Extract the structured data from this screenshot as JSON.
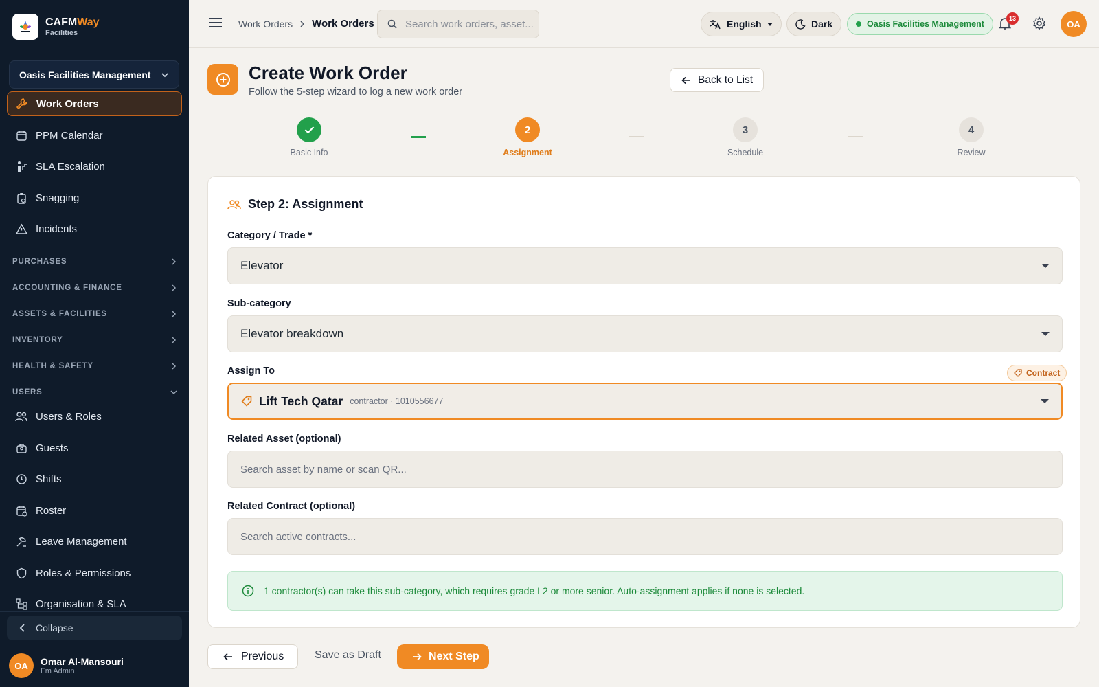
{
  "sidebar": {
    "brand_name_a": "CAFM",
    "brand_name_b": "Way",
    "brand_sub": "Facilities",
    "org": "Oasis Facilities Management",
    "items": [
      {
        "label": "Work Orders",
        "icon": "wrench-icon"
      },
      {
        "label": "PPM Calendar",
        "icon": "calendar-icon"
      },
      {
        "label": "SLA Escalation",
        "icon": "escalation-icon"
      },
      {
        "label": "Snagging",
        "icon": "clipboard-icon"
      },
      {
        "label": "Incidents",
        "icon": "warning-icon"
      }
    ],
    "sections": [
      {
        "label": "PURCHASES",
        "state": "collapsed"
      },
      {
        "label": "ACCOUNTING & FINANCE",
        "state": "collapsed"
      },
      {
        "label": "ASSETS & FACILITIES",
        "state": "collapsed"
      },
      {
        "label": "INVENTORY",
        "state": "collapsed"
      },
      {
        "label": "HEALTH & SAFETY",
        "state": "collapsed"
      },
      {
        "label": "USERS",
        "state": "expanded"
      }
    ],
    "user_items": [
      {
        "label": "Users & Roles",
        "icon": "users-icon"
      },
      {
        "label": "Guests",
        "icon": "guests-icon"
      },
      {
        "label": "Shifts",
        "icon": "clock-icon"
      },
      {
        "label": "Roster",
        "icon": "roster-icon"
      },
      {
        "label": "Leave Management",
        "icon": "leave-icon"
      },
      {
        "label": "Roles & Permissions",
        "icon": "shield-icon"
      },
      {
        "label": "Organisation & SLA",
        "icon": "org-chart-icon"
      }
    ],
    "collapse_label": "Collapse",
    "user": {
      "initials": "OA",
      "name": "Omar Al-Mansouri",
      "role": "Fm Admin"
    }
  },
  "topbar": {
    "breadcrumb": [
      "Work Orders",
      "Work Orders"
    ],
    "search_placeholder": "Search work orders, asset...",
    "language": "English",
    "theme": "Dark",
    "org": "Oasis Facilities Management",
    "notifications": "13",
    "avatar": "OA"
  },
  "page": {
    "title": "Create Work Order",
    "subtitle": "Follow the 5-step wizard to log a new work order",
    "back_label": "Back to List"
  },
  "stepper": [
    {
      "num": "1",
      "label": "Basic Info",
      "state": "done"
    },
    {
      "num": "2",
      "label": "Assignment",
      "state": "active"
    },
    {
      "num": "3",
      "label": "Schedule",
      "state": "todo"
    },
    {
      "num": "4",
      "label": "Review",
      "state": "todo"
    }
  ],
  "form": {
    "title": "Step 2: Assignment",
    "category_label": "Category / Trade *",
    "category_value": "Elevator",
    "subcategory_label": "Sub-category",
    "subcategory_value": "Elevator breakdown",
    "assign_label": "Assign To",
    "contract_tag": "Contract",
    "assign_name": "Lift Tech Qatar",
    "assign_meta": "contractor · 1010556677",
    "asset_label": "Related Asset (optional)",
    "asset_placeholder": "Search asset by name or scan QR...",
    "contract_label": "Related Contract (optional)",
    "contract_placeholder": "Search active contracts...",
    "info": "1 contractor(s) can take this sub-category, which requires grade L2 or more senior. Auto-assignment applies if none is selected."
  },
  "footer": {
    "previous": "Previous",
    "draft": "Save as Draft",
    "next": "Next Step"
  },
  "colors": {
    "accent": "#f08a24",
    "sidebar_bg": "#0f1b2a",
    "success": "#22a04b"
  }
}
